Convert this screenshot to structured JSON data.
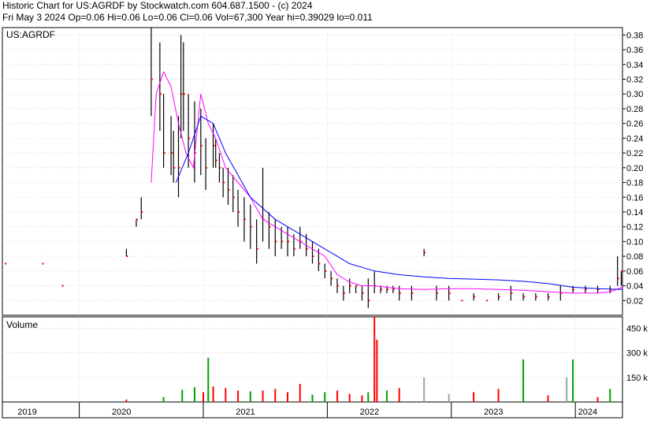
{
  "header": {
    "line1": "Historic Chart for US:AGRDF by Stockwatch.com 604.687.1500 - (c) 2024",
    "line2": "Fri May  3 2024   Op=0.06  Hi=0.06  Lo=0.06  Cl=0.06  Vol=67,300  Year hi=0.39029  lo=0.011"
  },
  "chart_data": [
    {
      "type": "line",
      "label": "US:AGRDF",
      "ylim": [
        0.0,
        0.39
      ],
      "y_ticks": [
        "0.38",
        "0.36",
        "0.34",
        "0.32",
        "0.30",
        "0.28",
        "0.26",
        "0.24",
        "0.22",
        "0.20",
        "0.18",
        "0.16",
        "0.14",
        "0.12",
        "0.10",
        "0.08",
        "0.06",
        "0.04",
        "0.02"
      ],
      "y_tick_values": [
        0.38,
        0.36,
        0.34,
        0.32,
        0.3,
        0.28,
        0.26,
        0.24,
        0.22,
        0.2,
        0.18,
        0.16,
        0.14,
        0.12,
        0.1,
        0.08,
        0.06,
        0.04,
        0.02
      ],
      "x_labels": [
        "2019",
        "2020",
        "2021",
        "2022",
        "2023",
        "2024"
      ],
      "x_label_t": [
        0.2,
        0.96,
        1.96,
        2.96,
        3.96,
        4.72
      ],
      "x_year_starts": [
        0.62,
        1.62,
        2.62,
        3.62,
        4.62
      ],
      "grid": true,
      "series": [
        {
          "style": "hlc-bars",
          "color": "#000000",
          "t": [
            0.02,
            0.32,
            0.48,
            1.0,
            1.08,
            1.12,
            1.2,
            1.27,
            1.3,
            1.36,
            1.38,
            1.42,
            1.44,
            1.46,
            1.5,
            1.55,
            1.6,
            1.64,
            1.7,
            1.72,
            1.75,
            1.78,
            1.82,
            1.86,
            1.9,
            1.95,
            2.0,
            2.05,
            2.1,
            2.15,
            2.2,
            2.25,
            2.3,
            2.35,
            2.4,
            2.45,
            2.5,
            2.55,
            2.6,
            2.65,
            2.7,
            2.75,
            2.8,
            2.85,
            2.9,
            2.95,
            3.0,
            3.05,
            3.1,
            3.15,
            3.2,
            3.3,
            3.4,
            3.5,
            3.6,
            3.7,
            3.8,
            3.9,
            4.0,
            4.1,
            4.2,
            4.3,
            4.4,
            4.5,
            4.6,
            4.7,
            4.8,
            4.9,
            4.96,
            4.99
          ],
          "hi": [
            0.07,
            0.07,
            0.04,
            0.09,
            0.13,
            0.16,
            0.39,
            0.37,
            0.3,
            0.27,
            0.25,
            0.27,
            0.38,
            0.37,
            0.3,
            0.29,
            0.28,
            0.24,
            0.26,
            0.24,
            0.22,
            0.2,
            0.2,
            0.19,
            0.17,
            0.16,
            0.15,
            0.13,
            0.2,
            0.14,
            0.13,
            0.12,
            0.12,
            0.11,
            0.12,
            0.11,
            0.1,
            0.09,
            0.07,
            0.06,
            0.05,
            0.04,
            0.05,
            0.04,
            0.04,
            0.05,
            0.06,
            0.04,
            0.04,
            0.04,
            0.04,
            0.04,
            0.09,
            0.04,
            0.04,
            0.02,
            0.03,
            0.02,
            0.03,
            0.04,
            0.03,
            0.03,
            0.03,
            0.04,
            0.04,
            0.04,
            0.04,
            0.04,
            0.08,
            0.06
          ],
          "lo": [
            0.07,
            0.07,
            0.04,
            0.08,
            0.12,
            0.13,
            0.27,
            0.25,
            0.2,
            0.19,
            0.18,
            0.16,
            0.24,
            0.25,
            0.2,
            0.18,
            0.19,
            0.17,
            0.2,
            0.2,
            0.18,
            0.16,
            0.15,
            0.14,
            0.12,
            0.1,
            0.09,
            0.07,
            0.1,
            0.09,
            0.08,
            0.09,
            0.08,
            0.08,
            0.09,
            0.08,
            0.07,
            0.06,
            0.05,
            0.04,
            0.03,
            0.02,
            0.03,
            0.03,
            0.02,
            0.01,
            0.03,
            0.03,
            0.03,
            0.03,
            0.02,
            0.02,
            0.08,
            0.02,
            0.02,
            0.02,
            0.02,
            0.02,
            0.02,
            0.02,
            0.02,
            0.02,
            0.02,
            0.02,
            0.03,
            0.03,
            0.03,
            0.03,
            0.04,
            0.04
          ],
          "cl": [
            0.07,
            0.07,
            0.04,
            0.08,
            0.13,
            0.14,
            0.32,
            0.3,
            0.22,
            0.22,
            0.2,
            0.2,
            0.3,
            0.3,
            0.24,
            0.22,
            0.23,
            0.2,
            0.23,
            0.21,
            0.2,
            0.18,
            0.17,
            0.16,
            0.14,
            0.13,
            0.12,
            0.09,
            0.13,
            0.12,
            0.1,
            0.1,
            0.1,
            0.09,
            0.1,
            0.09,
            0.08,
            0.07,
            0.06,
            0.05,
            0.04,
            0.03,
            0.04,
            0.04,
            0.03,
            0.02,
            0.04,
            0.035,
            0.035,
            0.035,
            0.03,
            0.03,
            0.085,
            0.03,
            0.03,
            0.02,
            0.025,
            0.02,
            0.025,
            0.03,
            0.025,
            0.025,
            0.025,
            0.03,
            0.035,
            0.035,
            0.035,
            0.035,
            0.05,
            0.06
          ]
        },
        {
          "style": "line",
          "color": "#ff00ff",
          "t": [
            1.2,
            1.24,
            1.3,
            1.36,
            1.42,
            1.48,
            1.54,
            1.6,
            1.66,
            1.72,
            1.8,
            1.9,
            2.0,
            2.1,
            2.2,
            2.3,
            2.4,
            2.5,
            2.6,
            2.7,
            2.8,
            2.9,
            3.0,
            3.2,
            3.4,
            3.6,
            3.8,
            4.0,
            4.2,
            4.4,
            4.6,
            4.8,
            4.9,
            5.0
          ],
          "y": [
            0.18,
            0.3,
            0.33,
            0.31,
            0.26,
            0.22,
            0.2,
            0.3,
            0.26,
            0.24,
            0.2,
            0.18,
            0.16,
            0.13,
            0.12,
            0.11,
            0.1,
            0.09,
            0.08,
            0.055,
            0.045,
            0.04,
            0.04,
            0.036,
            0.035,
            0.036,
            0.036,
            0.035,
            0.034,
            0.032,
            0.03,
            0.03,
            0.032,
            0.038
          ]
        },
        {
          "style": "line",
          "color": "#0000ff",
          "t": [
            1.4,
            1.5,
            1.6,
            1.7,
            1.8,
            1.9,
            2.0,
            2.1,
            2.2,
            2.3,
            2.4,
            2.5,
            2.6,
            2.7,
            2.8,
            2.9,
            3.0,
            3.2,
            3.4,
            3.6,
            3.8,
            4.0,
            4.2,
            4.4,
            4.6,
            4.8,
            5.0
          ],
          "y": [
            0.18,
            0.22,
            0.27,
            0.26,
            0.22,
            0.19,
            0.16,
            0.145,
            0.13,
            0.12,
            0.11,
            0.1,
            0.09,
            0.08,
            0.07,
            0.065,
            0.06,
            0.055,
            0.052,
            0.05,
            0.049,
            0.048,
            0.046,
            0.043,
            0.038,
            0.036,
            0.035
          ]
        }
      ]
    },
    {
      "type": "bar",
      "label": "Volume",
      "ylim": [
        0,
        520
      ],
      "y_ticks": [
        "450 k",
        "300 k",
        "150 k"
      ],
      "y_tick_values": [
        450,
        300,
        150
      ],
      "x": [
        1.0,
        1.3,
        1.45,
        1.55,
        1.62,
        1.66,
        1.7,
        1.8,
        1.9,
        2.0,
        2.1,
        2.2,
        2.3,
        2.4,
        2.5,
        2.6,
        2.7,
        2.8,
        2.9,
        2.95,
        3.0,
        3.02,
        3.1,
        3.2,
        3.4,
        3.6,
        3.8,
        4.0,
        4.2,
        4.4,
        4.55,
        4.6,
        4.8,
        4.9
      ],
      "values": [
        15,
        30,
        75,
        90,
        60,
        270,
        95,
        85,
        70,
        65,
        70,
        80,
        60,
        110,
        45,
        60,
        70,
        50,
        40,
        60,
        520,
        380,
        70,
        85,
        150,
        50,
        60,
        80,
        260,
        40,
        150,
        260,
        30,
        80
      ],
      "colors": [
        "#ff0000",
        "#00a000",
        "#00a000",
        "#00a000",
        "#ff0000",
        "#00a000",
        "#ff0000",
        "#ff0000",
        "#ff0000",
        "#00a000",
        "#ff0000",
        "#ff0000",
        "#ff0000",
        "#ff0000",
        "#00a000",
        "#00a000",
        "#ff0000",
        "#ff0000",
        "#ff0000",
        "#00a000",
        "#ff0000",
        "#ff0000",
        "#00a000",
        "#ff0000",
        "#a0a0a0",
        "#a0a0a0",
        "#ff0000",
        "#ff0000",
        "#00a000",
        "#ff0000",
        "#a0a0a0",
        "#00a000",
        "#ff0000",
        "#00a000"
      ]
    }
  ]
}
